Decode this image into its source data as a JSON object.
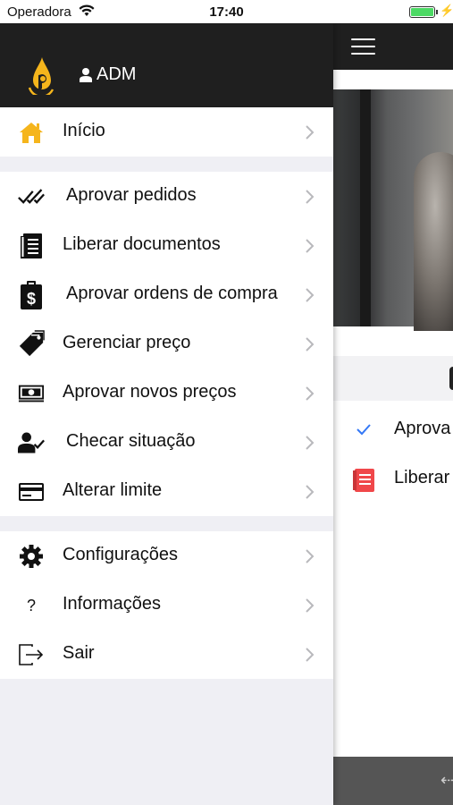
{
  "status_bar": {
    "carrier": "Operadora",
    "time": "17:40",
    "battery_level": 1.0
  },
  "drawer": {
    "user_name": "ADM",
    "sections": [
      [
        {
          "label": "Início",
          "icon": "home-icon"
        }
      ],
      [
        {
          "label": "Aprovar pedidos",
          "icon": "double-check-icon"
        },
        {
          "label": "Liberar documentos",
          "icon": "document-icon"
        },
        {
          "label": "Aprovar ordens de compra",
          "icon": "dollar-clipboard-icon"
        },
        {
          "label": "Gerenciar preço",
          "icon": "price-tag-icon"
        },
        {
          "label": "Aprovar novos preços",
          "icon": "money-bill-icon"
        },
        {
          "label": "Checar situação",
          "icon": "user-check-icon"
        },
        {
          "label": "Alterar limite",
          "icon": "credit-card-icon"
        }
      ],
      [
        {
          "label": "Configurações",
          "icon": "gear-icon"
        },
        {
          "label": "Informações",
          "icon": "question-icon"
        },
        {
          "label": "Sair",
          "icon": "logout-icon"
        }
      ]
    ]
  },
  "main": {
    "rows": [
      {
        "label": "Aprova",
        "icon": "checkmark-icon"
      },
      {
        "label": "Liberar",
        "icon": "red-document-icon"
      }
    ]
  },
  "colors": {
    "header_bg": "#1f1f1f",
    "accent_yellow": "#f5b51c",
    "check_blue": "#3478f6",
    "doc_red": "#f0474a"
  }
}
